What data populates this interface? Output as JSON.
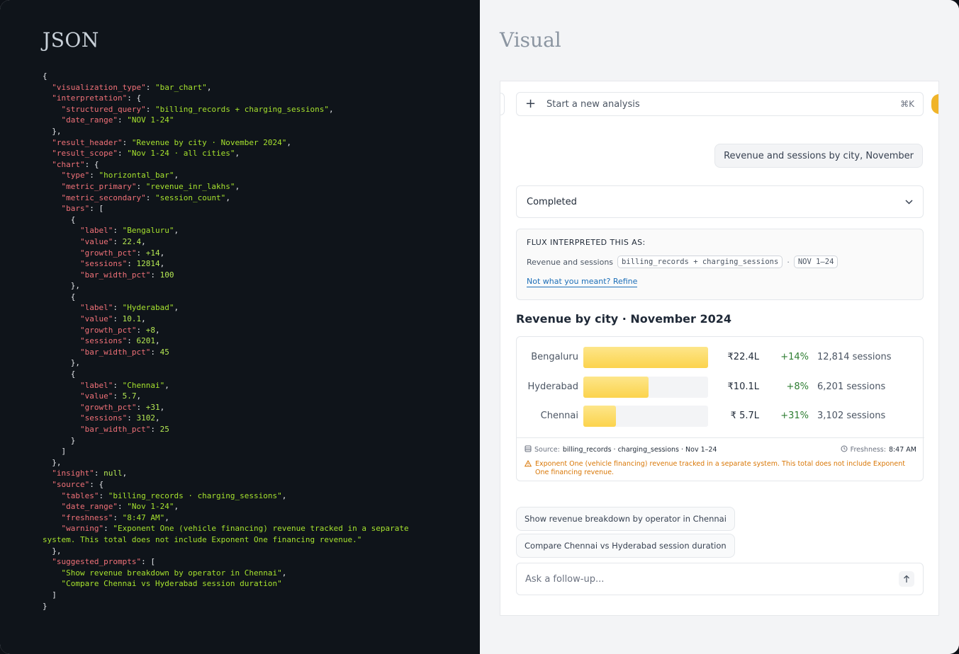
{
  "left": {
    "title": "JSON",
    "code": "{\n  \"visualization_type\": \"bar_chart\",\n  \"interpretation\": {\n    \"structured_query\": \"billing_records + charging_sessions\",\n    \"date_range\": \"NOV 1-24\"\n  },\n  \"result_header\": \"Revenue by city · November 2024\",\n  \"result_scope\": \"Nov 1-24 · all cities\",\n  \"chart\": {\n    \"type\": \"horizontal_bar\",\n    \"metric_primary\": \"revenue_inr_lakhs\",\n    \"metric_secondary\": \"session_count\",\n    \"bars\": [\n      {\n        \"label\": \"Bengaluru\",\n        \"value\": 22.4,\n        \"growth_pct\": +14,\n        \"sessions\": 12814,\n        \"bar_width_pct\": 100\n      },\n      {\n        \"label\": \"Hyderabad\",\n        \"value\": 10.1,\n        \"growth_pct\": +8,\n        \"sessions\": 6201,\n        \"bar_width_pct\": 45\n      },\n      {\n        \"label\": \"Chennai\",\n        \"value\": 5.7,\n        \"growth_pct\": +31,\n        \"sessions\": 3102,\n        \"bar_width_pct\": 25\n      }\n    ]\n  },\n  \"insight\": null,\n  \"source\": {\n    \"tables\": \"billing_records · charging_sessions\",\n    \"date_range\": \"Nov 1-24\",\n    \"freshness\": \"8:47 AM\",\n    \"warning\": \"Exponent One (vehicle financing) revenue tracked in a separate\nsystem. This total does not include Exponent One financing revenue.\"\n  },\n  \"suggested_prompts\": [\n    \"Show revenue breakdown by operator in Chennai\",\n    \"Compare Chennai vs Hyderabad session duration\"\n  ]\n}"
  },
  "right": {
    "title": "Visual",
    "topbar": {
      "label": "Start a new analysis",
      "shortcut": "⌘K"
    },
    "user_message": "Revenue and sessions by city, November",
    "status": "Completed",
    "interpretation": {
      "title": "FLUX INTERPRETED THIS AS:",
      "prefix": "Revenue and sessions",
      "query_chip": "billing_records + charging_sessions",
      "separator": "·",
      "date_chip": "NOV 1–24",
      "refine_link": "Not what you meant? Refine"
    },
    "result_header": "Revenue by city · November 2024",
    "bars": [
      {
        "label": "Bengaluru",
        "value_text": "₹22.4L",
        "growth": "+14%",
        "sessions": "12,814 sessions",
        "fill_pct": 100
      },
      {
        "label": "Hyderabad",
        "value_text": "₹10.1L",
        "growth": "+8%",
        "sessions": "6,201 sessions",
        "fill_pct": 52
      },
      {
        "label": "Chennai",
        "value_text": "₹ 5.7L",
        "growth": "+31%",
        "sessions": "3,102 sessions",
        "fill_pct": 26
      }
    ],
    "footer": {
      "source_label": "Source:",
      "source_value": "billing_records · charging_sessions · Nov 1–24",
      "freshness_label": "Freshness:",
      "freshness_value": "8:47 AM",
      "warning": "Exponent One (vehicle financing) revenue tracked in a separate system. This total does not include Exponent One financing revenue."
    },
    "suggested_prompts": [
      "Show revenue breakdown by operator in Chennai",
      "Compare Chennai vs Hyderabad session duration"
    ],
    "followup_placeholder": "Ask a follow-up..."
  },
  "colors": {
    "bar": "#fcd34d",
    "growth": "#2e7d32",
    "warning": "#d97706",
    "link": "#1d6fb8"
  }
}
